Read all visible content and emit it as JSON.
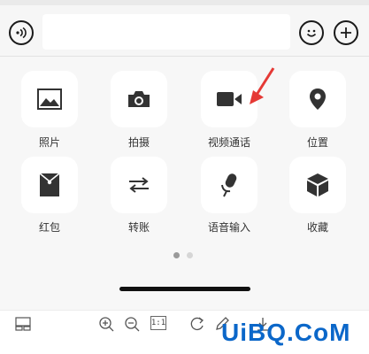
{
  "input_bar": {
    "voice_icon": "voice-wave-icon",
    "text_placeholder": "",
    "emoji_icon": "smiley-icon",
    "plus_icon": "plus-icon"
  },
  "panel": {
    "items": [
      {
        "label": "照片",
        "icon": "image-icon"
      },
      {
        "label": "拍摄",
        "icon": "camera-icon"
      },
      {
        "label": "视频通话",
        "icon": "video-camera-icon"
      },
      {
        "label": "位置",
        "icon": "location-pin-icon"
      },
      {
        "label": "红包",
        "icon": "red-envelope-icon"
      },
      {
        "label": "转账",
        "icon": "transfer-arrows-icon"
      },
      {
        "label": "语音输入",
        "icon": "microphone-icon"
      },
      {
        "label": "收藏",
        "icon": "cube-icon"
      }
    ],
    "page_dots": {
      "count": 2,
      "active_index": 0
    }
  },
  "toolbar": {
    "zoom_label": "1:1"
  },
  "watermark": "UiBQ.CoM",
  "colors": {
    "icon": "#333333",
    "annotation_arrow": "#e53935",
    "watermark": "#0b67c9"
  }
}
